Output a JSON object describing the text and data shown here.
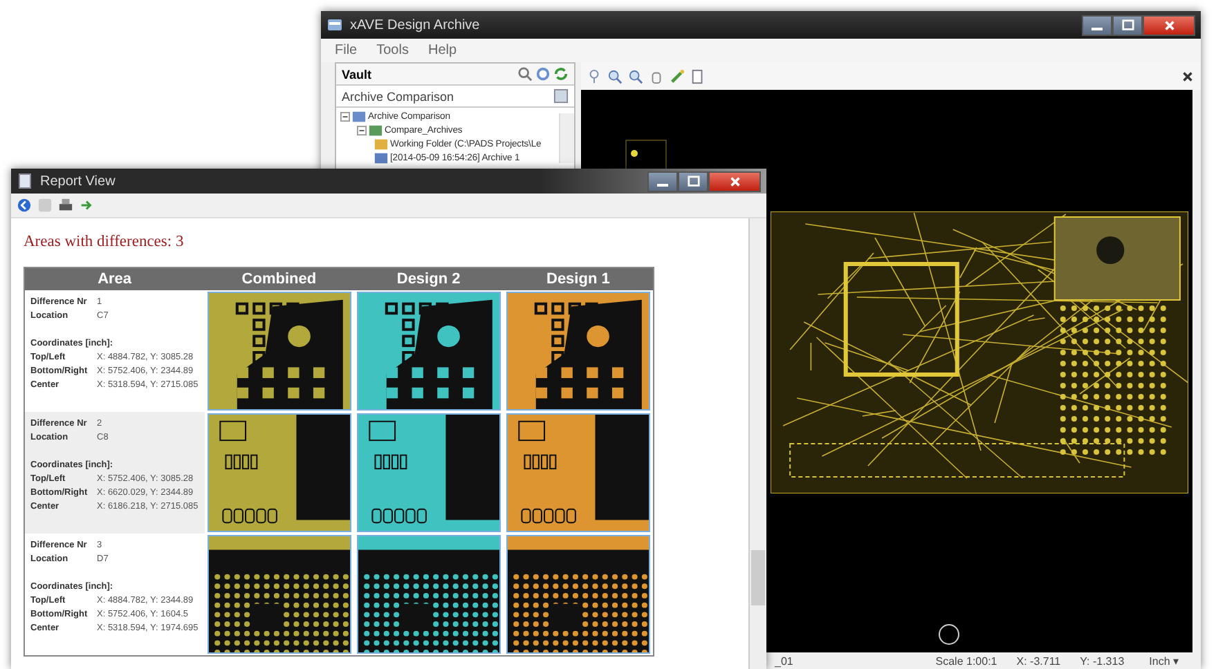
{
  "archive_window": {
    "title": "xAVE Design Archive",
    "menu": [
      "File",
      "Tools",
      "Help"
    ],
    "vault": {
      "title": "Vault",
      "dropdown_value": "Archive Comparison",
      "tree": [
        {
          "label": "Archive Comparison",
          "kind": "root",
          "expanded": true,
          "children": [
            {
              "label": "Compare_Archives",
              "kind": "folder",
              "expanded": true,
              "children": [
                {
                  "label": "Working Folder (C:\\PADS Projects\\Le",
                  "kind": "workfolder"
                },
                {
                  "label": "[2014-05-09 16:54:26] Archive 1",
                  "kind": "archive"
                }
              ]
            }
          ]
        }
      ]
    },
    "status_bar": {
      "layer": "_01",
      "scale": "Scale 1:00:1",
      "x": "X: -3.711",
      "y": "Y: -1.313",
      "unit": "Inch ▾"
    }
  },
  "report_window": {
    "title": "Report View",
    "heading": "Areas with differences: 3",
    "columns": [
      {
        "label": "Area",
        "kind": "text"
      },
      {
        "label": "Combined",
        "kind": "image",
        "color": "#b3a83c"
      },
      {
        "label": "Design 2",
        "kind": "image",
        "color": "#3fc2c0"
      },
      {
        "label": "Design 1",
        "kind": "image",
        "color": "#dc9530"
      }
    ],
    "rows": [
      {
        "kind": "pads",
        "nr_label": "Difference Nr",
        "nr": "1",
        "location_label": "Location",
        "location": "C7",
        "coords_label": "Coordinates [inch]:",
        "coords": [
          {
            "label": "Top/Left",
            "value": "X: 4884.782, Y: 3085.28"
          },
          {
            "label": "Bottom/Right",
            "value": "X: 5752.406, Y: 2344.89"
          },
          {
            "label": "Center",
            "value": "X: 5318.594, Y: 2715.085"
          }
        ]
      },
      {
        "kind": "connector",
        "nr_label": "Difference Nr",
        "nr": "2",
        "location_label": "Location",
        "location": "C8",
        "coords_label": "Coordinates [inch]:",
        "coords": [
          {
            "label": "Top/Left",
            "value": "X: 5752.406, Y: 3085.28"
          },
          {
            "label": "Bottom/Right",
            "value": "X: 6620.029, Y: 2344.89"
          },
          {
            "label": "Center",
            "value": "X: 6186.218, Y: 2715.085"
          }
        ]
      },
      {
        "kind": "grid",
        "nr_label": "Difference Nr",
        "nr": "3",
        "location_label": "Location",
        "location": "D7",
        "coords_label": "Coordinates [inch]:",
        "coords": [
          {
            "label": "Top/Left",
            "value": "X: 4884.782, Y: 2344.89"
          },
          {
            "label": "Bottom/Right",
            "value": "X: 5752.406, Y: 1604.5"
          },
          {
            "label": "Center",
            "value": "X: 5318.594, Y: 1974.695"
          }
        ]
      }
    ]
  }
}
